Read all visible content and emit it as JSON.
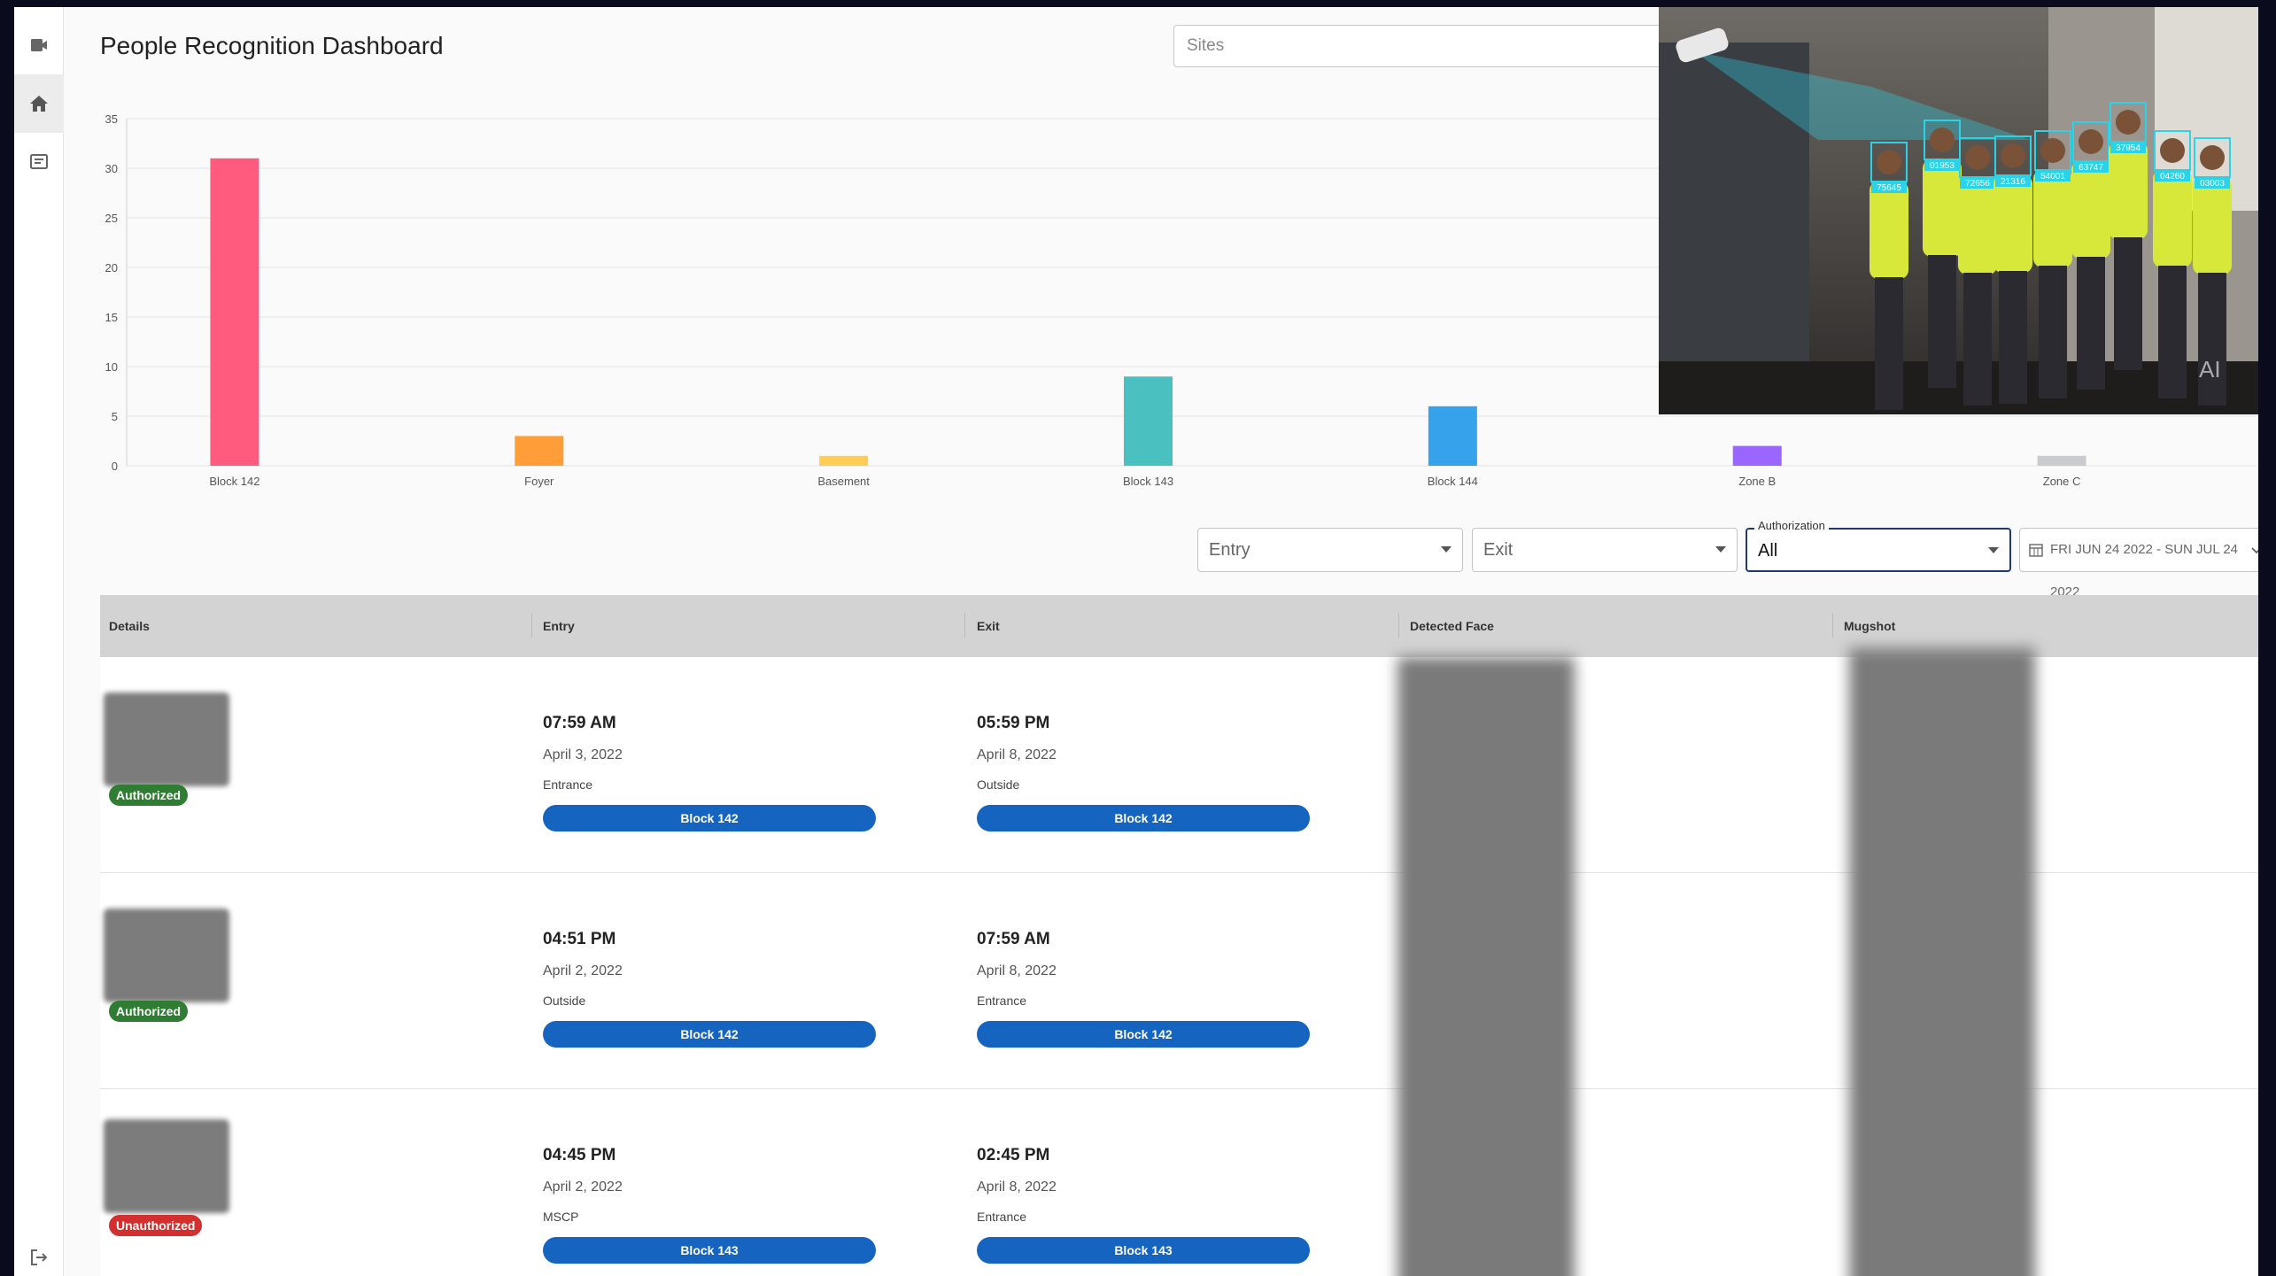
{
  "header": {
    "title": "People Recognition Dashboard",
    "sites_placeholder": "Sites"
  },
  "sidebar": {
    "items": [
      {
        "icon": "video-camera-icon"
      },
      {
        "icon": "home-icon"
      },
      {
        "icon": "list-icon"
      },
      {
        "icon": "logout-icon"
      }
    ]
  },
  "chart_data": {
    "type": "bar",
    "categories": [
      "Block 142",
      "Foyer",
      "Basement",
      "Block 143",
      "Block 144",
      "Zone B",
      "Zone C"
    ],
    "values": [
      31,
      3,
      1,
      9,
      6,
      2,
      1
    ],
    "colors": [
      "#ff5b7e",
      "#ff9d38",
      "#ffcd56",
      "#4bc0c0",
      "#36a2eb",
      "#9966ff",
      "#c9cbcf"
    ],
    "ylim": [
      0,
      35
    ],
    "yticks": [
      "0",
      "5",
      "10",
      "15",
      "20",
      "25",
      "30",
      "35"
    ],
    "grid": true
  },
  "filters": {
    "entry_label": "Entry",
    "exit_label": "Exit",
    "authorization_legend": "Authorization",
    "authorization_value": "All",
    "date_range": "FRI JUN 24 2022 - SUN JUL 24 2022"
  },
  "table": {
    "columns": [
      "Details",
      "Entry",
      "Exit",
      "Detected Face",
      "Mugshot"
    ],
    "rows": [
      {
        "status": "Authorized",
        "status_color": "#2e7d32",
        "entry_time": "07:59 AM",
        "entry_date": "April 3, 2022",
        "entry_loc": "Entrance",
        "entry_block": "Block 142",
        "exit_time": "05:59 PM",
        "exit_date": "April 8, 2022",
        "exit_loc": "Outside",
        "exit_block": "Block 142"
      },
      {
        "status": "Authorized",
        "status_color": "#2e7d32",
        "entry_time": "04:51 PM",
        "entry_date": "April 2, 2022",
        "entry_loc": "Outside",
        "entry_block": "Block 142",
        "exit_time": "07:59 AM",
        "exit_date": "April 8, 2022",
        "exit_loc": "Entrance",
        "exit_block": "Block 142"
      },
      {
        "status": "Unauthorized",
        "status_color": "#d32f2f",
        "entry_time": "04:45 PM",
        "entry_date": "April 2, 2022",
        "entry_loc": "MSCP",
        "entry_block": "Block 143",
        "exit_time": "02:45 PM",
        "exit_date": "April 8, 2022",
        "exit_loc": "Entrance",
        "exit_block": "Block 143"
      }
    ]
  },
  "inset": {
    "ids": [
      "75645",
      "01953",
      "72656",
      "21316",
      "54001",
      "63747",
      "37954",
      "04260",
      "03003"
    ],
    "watermark": "AI"
  }
}
